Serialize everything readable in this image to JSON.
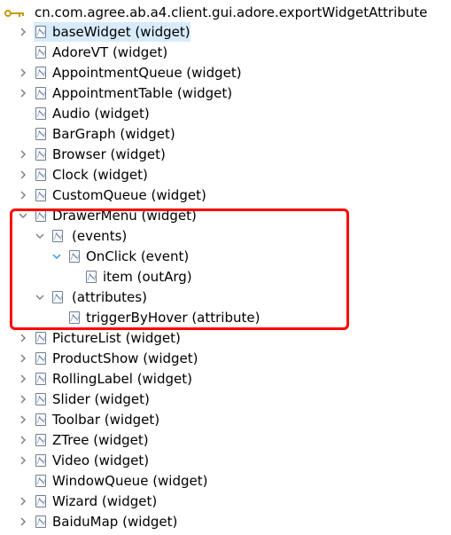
{
  "tree": {
    "root": {
      "label": "cn.com.agree.ab.a4.client.gui.adore.exportWidgetAttribute",
      "icon": "key-package-icon"
    },
    "items": [
      {
        "label": "baseWidget (widget)",
        "expanded": false,
        "selected": true
      },
      {
        "label": "AdoreVT (widget)",
        "expanded": false
      },
      {
        "label": "AppointmentQueue (widget)",
        "expanded": false
      },
      {
        "label": "AppointmentTable (widget)",
        "expanded": false
      },
      {
        "label": "Audio (widget)",
        "expanded": false
      },
      {
        "label": "BarGraph (widget)",
        "expanded": false
      },
      {
        "label": "Browser (widget)",
        "expanded": false
      },
      {
        "label": "Clock (widget)",
        "expanded": false
      },
      {
        "label": "CustomQueue (widget)",
        "expanded": false
      },
      {
        "label": "DrawerMenu (widget)",
        "expanded": true
      },
      {
        "label": "(events)",
        "expanded": true
      },
      {
        "label": "OnClick (event)",
        "expanded": true
      },
      {
        "label": "item (outArg)",
        "expanded": false
      },
      {
        "label": "(attributes)",
        "expanded": true
      },
      {
        "label": "triggerByHover (attribute)",
        "expanded": false
      },
      {
        "label": "PictureList (widget)",
        "expanded": false
      },
      {
        "label": "ProductShow (widget)",
        "expanded": false
      },
      {
        "label": "RollingLabel (widget)",
        "expanded": false
      },
      {
        "label": "Slider (widget)",
        "expanded": false
      },
      {
        "label": "Toolbar (widget)",
        "expanded": false
      },
      {
        "label": "ZTree (widget)",
        "expanded": false
      },
      {
        "label": "Video (widget)",
        "expanded": false
      },
      {
        "label": "WindowQueue (widget)",
        "expanded": false
      },
      {
        "label": "Wizard (widget)",
        "expanded": false
      },
      {
        "label": "BaiduMap (widget)",
        "expanded": false
      }
    ]
  },
  "colors": {
    "selection": "#d7ebfb",
    "highlight_box": "#ff0000",
    "twisty": "#808080",
    "event_twisty": "#4aa3df",
    "icon_border": "#6f7f93",
    "package_icon": "#c99a13"
  },
  "icons": {
    "collapsed": "chevron-right-icon",
    "expanded": "chevron-down-icon",
    "expanded_event": "chevron-down-blue-icon",
    "node": "xml-node-icon"
  }
}
